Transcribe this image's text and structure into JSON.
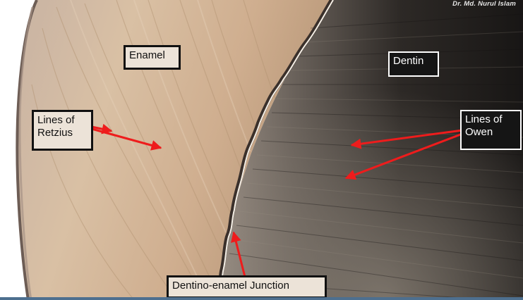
{
  "credit": "Dr. Md. Nurul Islam",
  "labels": {
    "enamel": "Enamel",
    "dentin": "Dentin",
    "lines_of_retzius": "Lines of\nRetzius",
    "lines_of_owen": "Lines of\nOwen",
    "dej": "Dentino-enamel Junction"
  },
  "colors": {
    "enamel": "#d2b69a",
    "dentin": "#2a2623",
    "arrow": "#ee1c1c",
    "background": "#ffffff"
  }
}
